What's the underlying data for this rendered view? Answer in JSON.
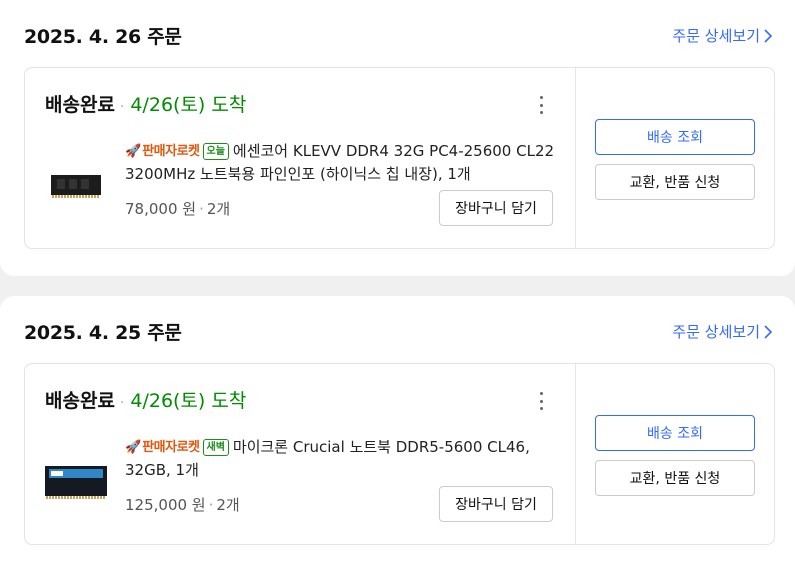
{
  "orders": [
    {
      "date": "2025. 4. 26 주문",
      "detail_link": "주문 상세보기",
      "status": "배송완료",
      "arrival": "4/26(토) 도착",
      "seller_badge": "판매자로켓",
      "delivery_tag": "오늘",
      "product_name": "에센코어 KLEVV DDR4 32G PC4-25600 CL22 3200MHz 노트북용 파인인포 (하이닉스 칩 내장), 1개",
      "price": "78,000 원",
      "quantity": "2개",
      "cart_button": "장바구니 담기",
      "track_button": "배송 조회",
      "return_button": "교환, 반품 신청",
      "thumbnail_icon": "ram-module-icon"
    },
    {
      "date": "2025. 4. 25 주문",
      "detail_link": "주문 상세보기",
      "status": "배송완료",
      "arrival": "4/26(토) 도착",
      "seller_badge": "판매자로켓",
      "delivery_tag": "새벽",
      "product_name": "마이크론 Crucial 노트북 DDR5-5600 CL46, 32GB, 1개",
      "price": "125,000 원",
      "quantity": "2개",
      "cart_button": "장바구니 담기",
      "track_button": "배송 조회",
      "return_button": "교환, 반품 신청",
      "thumbnail_icon": "ram-module-icon"
    }
  ],
  "colors": {
    "link_blue": "#346aff",
    "arrival_green": "#008c00",
    "rocket_orange": "#e5560d"
  }
}
